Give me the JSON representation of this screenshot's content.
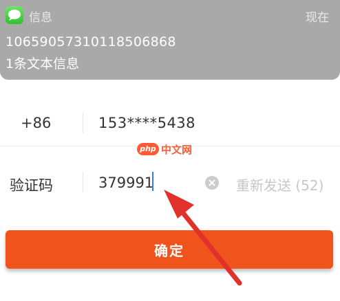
{
  "notification": {
    "app_name": "信息",
    "time": "现在",
    "sender": "10659057310118506868",
    "body": "1条文本信息"
  },
  "form": {
    "country_code": "+86",
    "phone_number": "153****5438",
    "code_label": "验证码",
    "code_value": "379991",
    "resend_label": "重新发送 (52)",
    "confirm_label": "确定"
  },
  "watermark": {
    "logo": "php",
    "text": "中文网"
  },
  "colors": {
    "accent": "#f0531c",
    "annotation": "#e0322b",
    "banner": "#a9a9a9"
  }
}
